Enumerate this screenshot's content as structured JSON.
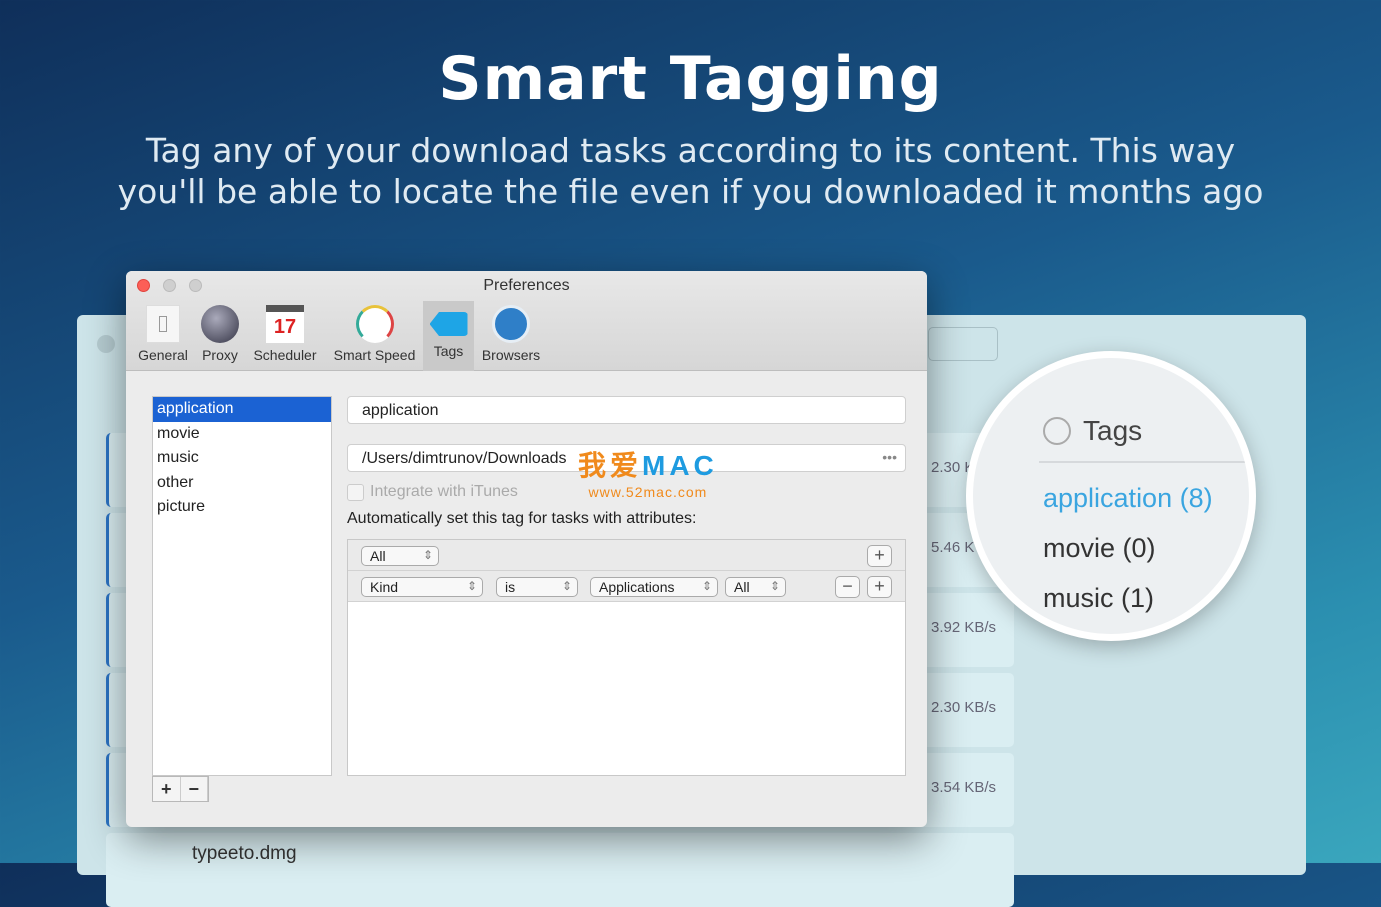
{
  "hero": {
    "title": "Smart Tagging",
    "subtitle_line1": "Tag any of your download tasks according to its content. This way",
    "subtitle_line2": "you'll be able to locate the file even if you downloaded it months ago"
  },
  "background_app": {
    "speeds": [
      "2.30 K",
      "5.46 K",
      "3.92 KB/s",
      "2.30 KB/s",
      "3.54 KB/s"
    ],
    "last_file": "typeeto.dmg"
  },
  "prefs": {
    "title": "Preferences",
    "toolbar": [
      {
        "label": "General",
        "icon": "switch-icon"
      },
      {
        "label": "Proxy",
        "icon": "network-globe-icon"
      },
      {
        "label": "Scheduler",
        "icon": "calendar-icon",
        "badge": "17"
      },
      {
        "label": "Smart Speed",
        "icon": "speedometer-icon"
      },
      {
        "label": "Tags",
        "icon": "tag-icon",
        "selected": true
      },
      {
        "label": "Browsers",
        "icon": "compass-icon"
      }
    ],
    "tags": [
      "application",
      "movie",
      "music",
      "other",
      "picture"
    ],
    "selected_tag": "application",
    "add_label": "+",
    "remove_label": "−",
    "tag_name": "application",
    "folder_path": "/Users/dimtrunov/Downloads",
    "folder_more": "•••",
    "itunes_label": "Integrate with iTunes",
    "auto_label": "Automatically set this tag for tasks with attributes:",
    "rule_match": "All",
    "rule": {
      "attribute": "Kind",
      "operator": "is",
      "value": "Applications",
      "scope": "All"
    }
  },
  "watermark": {
    "brand_cn": "我爱",
    "brand_en": "MAC",
    "url": "www.52mac.com"
  },
  "magnifier": {
    "header": "Tags",
    "items": [
      "application (8)",
      "movie (0)",
      "music (1)"
    ],
    "accent": "#3aa5e0"
  }
}
